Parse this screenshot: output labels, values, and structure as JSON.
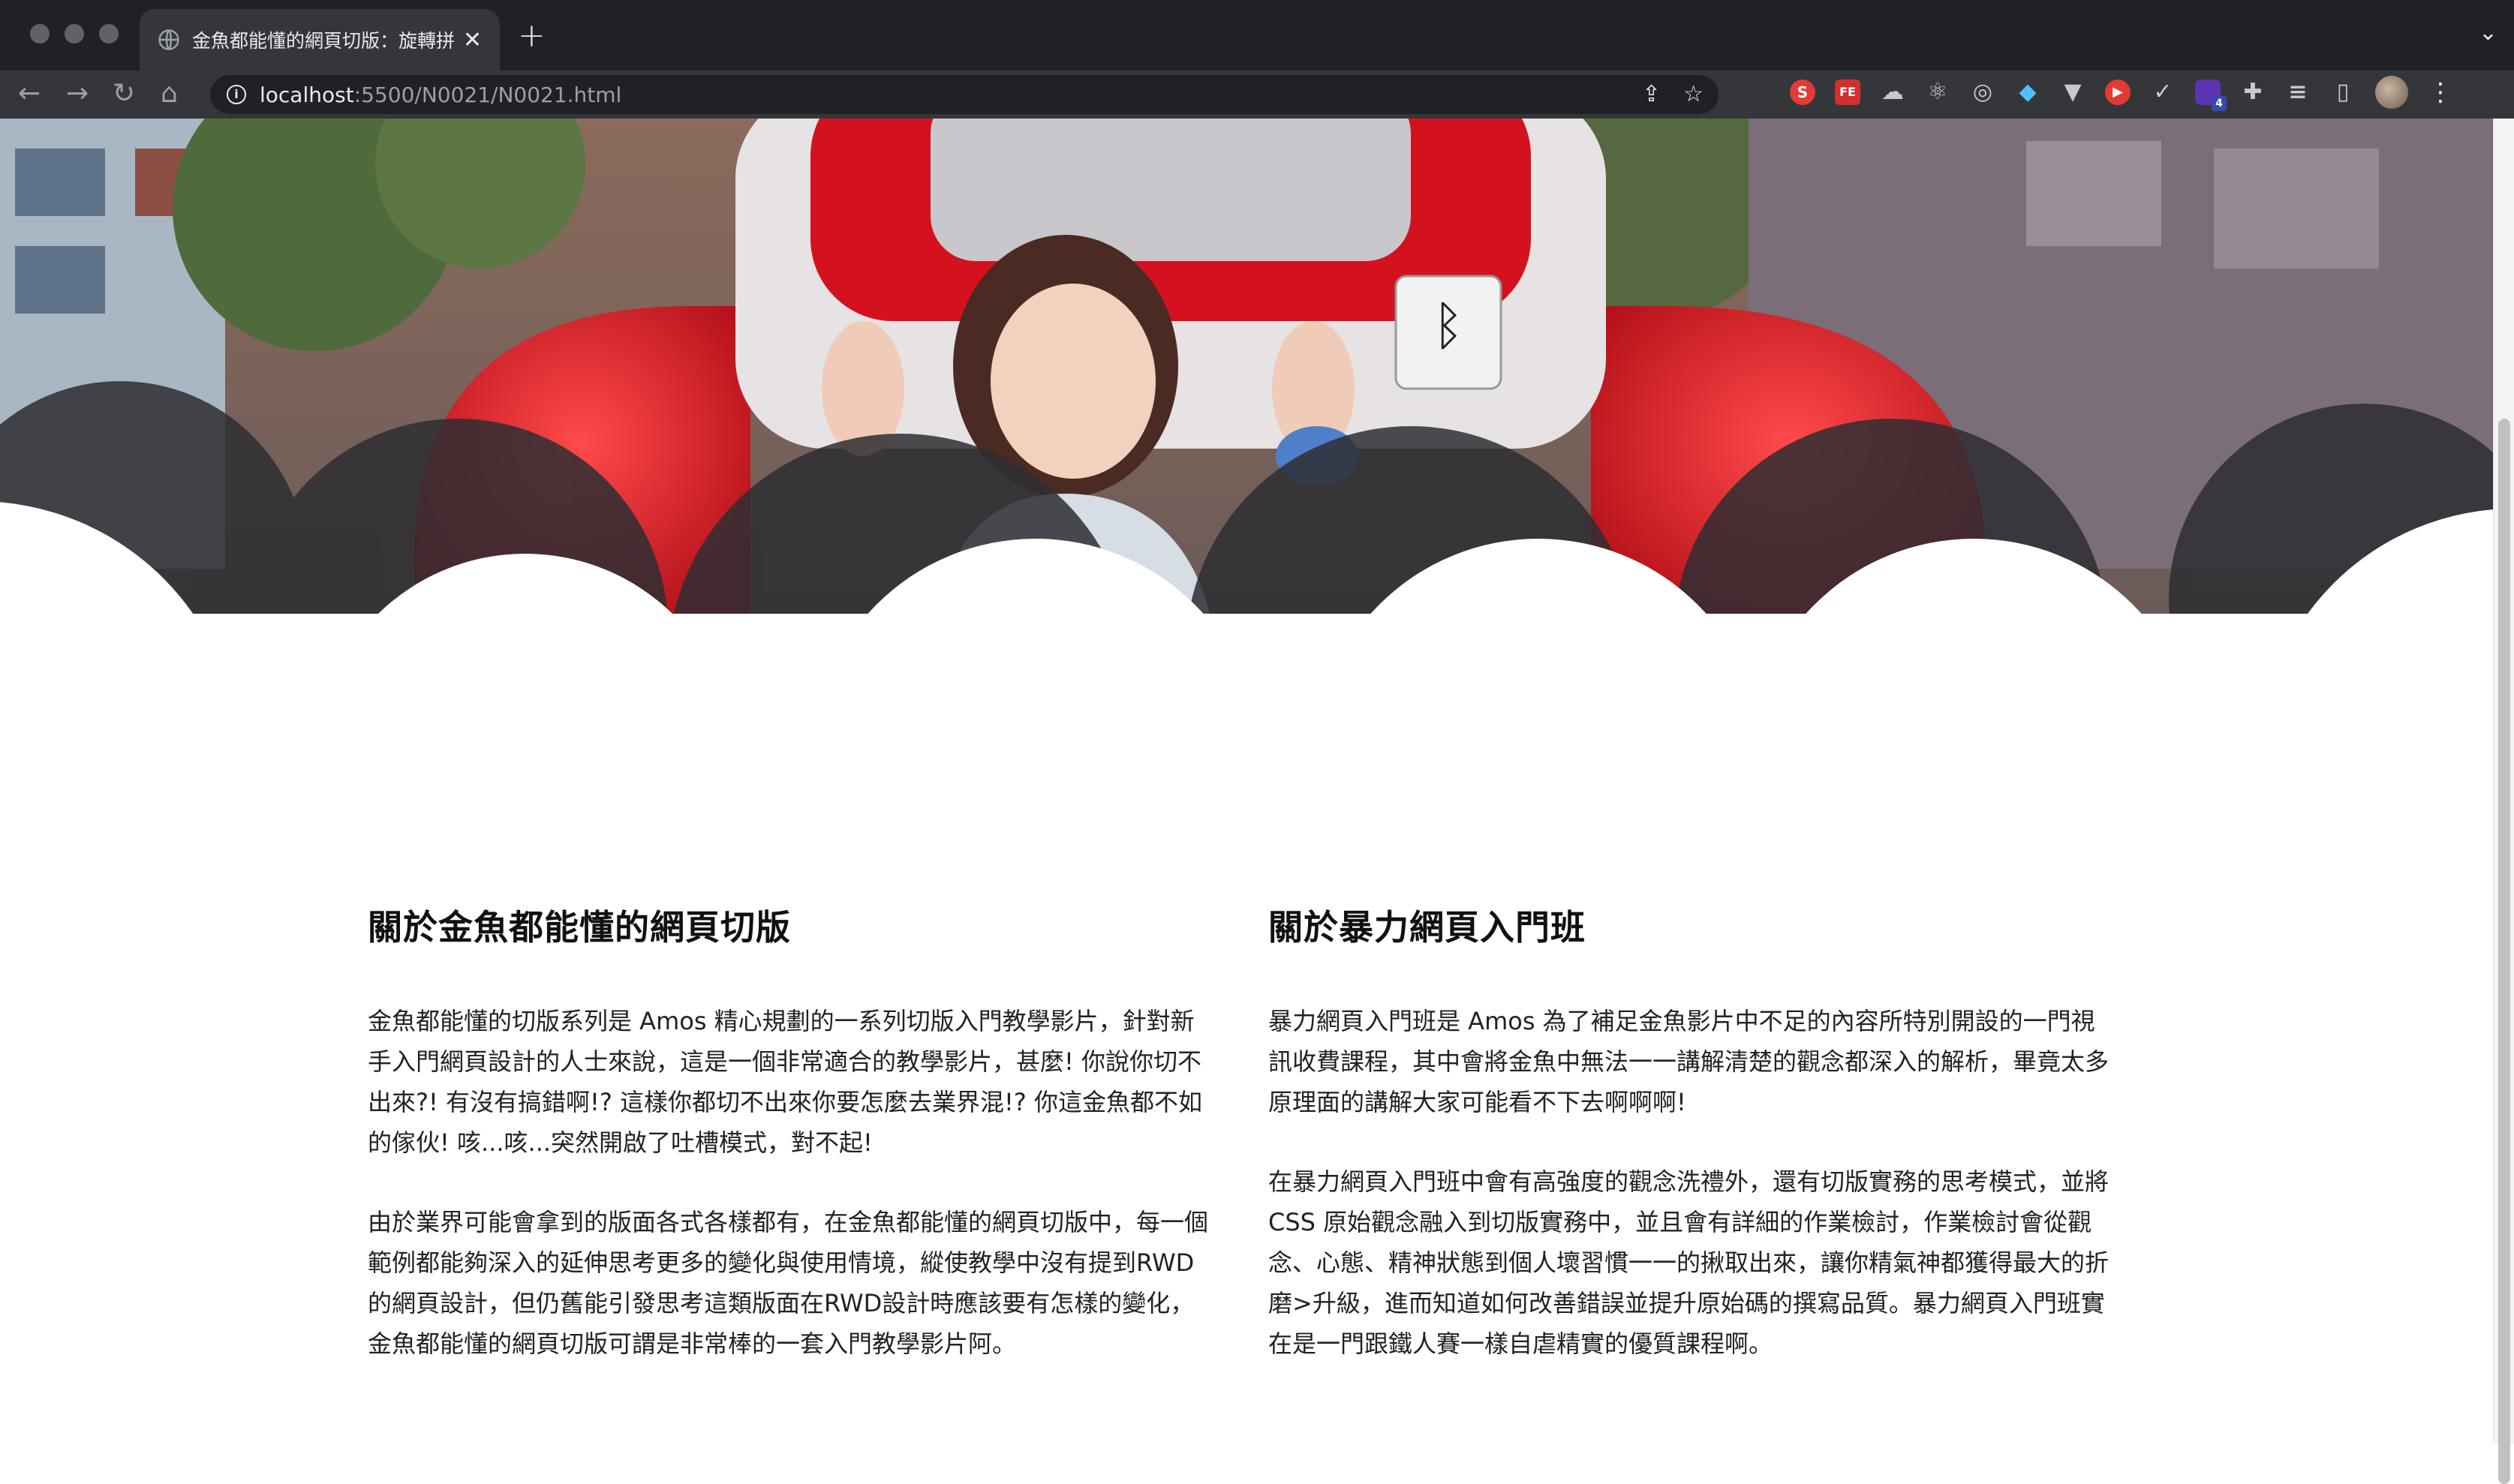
{
  "browser": {
    "tab_title": "金魚都能懂的網頁切版：旋轉拼",
    "new_tab": "+",
    "url_host": "localhost",
    "url_path": ":5500/N0021/N0021.html",
    "ext_badge": "4"
  },
  "about_goldfish": {
    "heading": "關於金魚都能懂的網頁切版",
    "p1": "金魚都能懂的切版系列是 Amos 精心規劃的一系列切版入門教學影片，針對新手入門網頁設計的人士來說，這是一個非常適合的教學影片，甚麼! 你說你切不出來?! 有沒有搞錯啊!? 這樣你都切不出來你要怎麼去業界混!? 你這金魚都不如的傢伙! 咳...咳...突然開啟了吐槽模式，對不起!",
    "p2": "由於業界可能會拿到的版面各式各樣都有，在金魚都能懂的網頁切版中，每一個範例都能夠深入的延伸思考更多的變化與使用情境，縱使教學中沒有提到RWD的網頁設計，但仍舊能引發思考這類版面在RWD設計時應該要有怎樣的變化，金魚都能懂的網頁切版可謂是非常棒的一套入門教學影片阿。"
  },
  "about_bootcamp": {
    "heading": "關於暴力網頁入門班",
    "p1": "暴力網頁入門班是 Amos 為了補足金魚影片中不足的內容所特別開設的一門視訊收費課程，其中會將金魚中無法一一講解清楚的觀念都深入的解析，畢竟太多原理面的講解大家可能看不下去啊啊啊!",
    "p2": "在暴力網頁入門班中會有高強度的觀念洗禮外，還有切版實務的思考模式，並將 CSS 原始觀念融入到切版實務中，並且會有詳細的作業檢討，作業檢討會從觀念、心態、精神狀態到個人壞習慣一一的揪取出來，讓你精氣神都獲得最大的折磨>升級，進而知道如何改善錯誤並提升原始碼的撰寫品質。暴力網頁入門班實在是一門跟鐵人賽一樣自虐精實的優質課程啊。"
  }
}
